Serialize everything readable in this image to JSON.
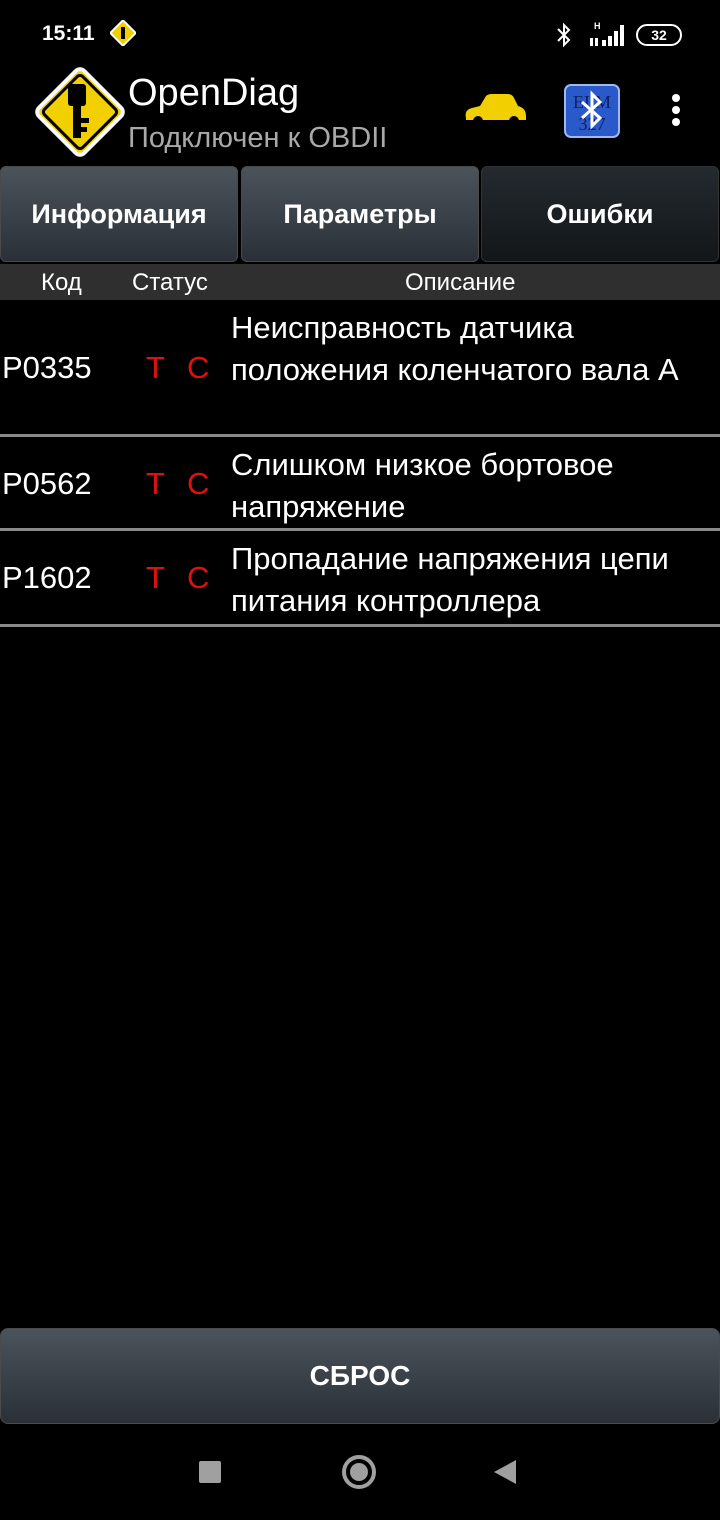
{
  "status_bar": {
    "time": "15:11",
    "network_label": "H",
    "battery_level": "32"
  },
  "app_bar": {
    "title": "OpenDiag",
    "subtitle": "Подключен к OBDII",
    "logo_icon": "key-warning-sign-icon",
    "car_icon_color": "#f2cf00",
    "adapter_icon_text": "ELM 327"
  },
  "tabs": [
    {
      "label": "Информация",
      "active": false
    },
    {
      "label": "Параметры",
      "active": false
    },
    {
      "label": "Ошибки",
      "active": true
    }
  ],
  "columns": {
    "code": "Код",
    "status": "Статус",
    "description": "Описание"
  },
  "errors": [
    {
      "code": "P0335",
      "status_t": "T",
      "status_c": "C",
      "description": "Неисправность датчика положения коленчатого вала А"
    },
    {
      "code": "P0562",
      "status_t": "T",
      "status_c": "C",
      "description": "Слишком низкое бортовое напряжение"
    },
    {
      "code": "P1602",
      "status_t": "T",
      "status_c": "C",
      "description": "Пропадание напряжения цепи питания контроллера"
    }
  ],
  "reset_button": {
    "label": "СБРОС"
  },
  "colors": {
    "background": "#000000",
    "status_red": "#e01010",
    "subtitle_gray": "#a9a9a9",
    "header_gray": "#2f2f2f"
  }
}
